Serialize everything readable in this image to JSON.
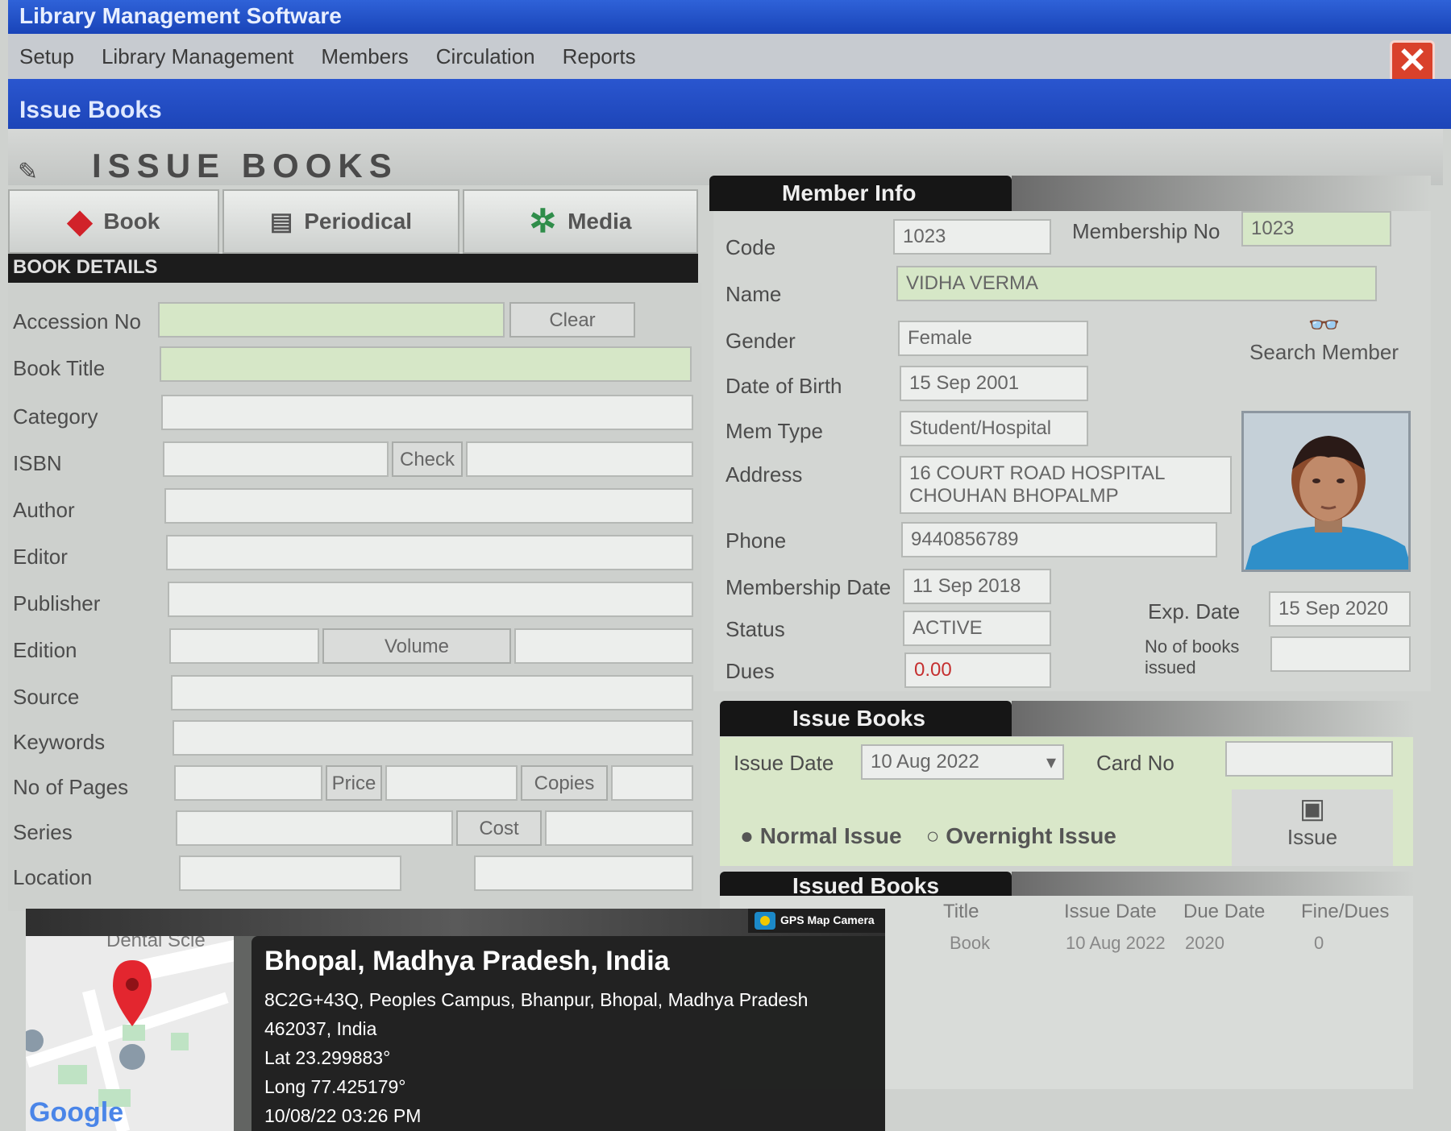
{
  "window": {
    "title": "Library Management Software"
  },
  "menu": [
    "Setup",
    "Library Management",
    "Members",
    "Circulation",
    "Reports"
  ],
  "subwindow": {
    "title": "Issue Books"
  },
  "form": {
    "heading": "ISSUE BOOKS"
  },
  "tabs": [
    "Book",
    "Periodical",
    "Media"
  ],
  "book_details": {
    "header": "BOOK DETAILS",
    "labels": [
      "Accession No",
      "Book Title",
      "Category",
      "ISBN",
      "Author",
      "Editor",
      "Publisher",
      "Edition",
      "Source",
      "Keywords",
      "No of Pages",
      "Series",
      "Location"
    ],
    "buttons": {
      "clear": "Clear",
      "check": "Check",
      "volume": "Volume",
      "price": "Price",
      "copies": "Copies",
      "cost": "Cost"
    }
  },
  "member_info": {
    "header": "Member Info",
    "labels": {
      "code": "Code",
      "membership_no": "Membership No",
      "name": "Name",
      "gender": "Gender",
      "dob": "Date of Birth",
      "member_type": "Mem Type",
      "address": "Address",
      "phone": "Phone",
      "membership_date": "Membership Date",
      "status": "Status",
      "dues": "Dues",
      "exp_date": "Exp. Date",
      "books_issued": "No of books issued"
    },
    "values": {
      "code": "1023",
      "membership_no": "1023",
      "name": "VIDHA VERMA",
      "gender": "Female",
      "dob": "15 Sep 2001",
      "member_type": "Student/Hospital",
      "address_1": "16 COURT ROAD HOSPITAL",
      "address_2": "CHOUHAN BHOPALMP",
      "phone": "9440856789",
      "membership_date": "11 Sep 2018",
      "status": "ACTIVE",
      "dues": "0.00",
      "exp_date": "15 Sep 2020",
      "books_issued": ""
    },
    "search_member": "Search Member"
  },
  "issue": {
    "header": "Issue Books",
    "issue_date_label": "Issue Date",
    "issue_date": "10 Aug 2022",
    "card_no_label": "Card No",
    "normal": "Normal Issue",
    "overnight": "Overnight Issue",
    "issue_button": "Issue"
  },
  "issued_books": {
    "header": "Issued Books",
    "columns": [
      "Title",
      "Issue Date",
      "Due Date",
      "Fine/Dues"
    ],
    "rows": [
      [
        "Book",
        "10 Aug 2022",
        "2020",
        "0"
      ]
    ]
  },
  "gps": {
    "app": "GPS Map Camera",
    "place": "Bhopal, Madhya Pradesh, India",
    "address_1": "8C2G+43Q, Peoples Campus, Bhanpur, Bhopal, Madhya Pradesh",
    "address_2": "462037, India",
    "lat": "Lat 23.299883°",
    "long": "Long 77.425179°",
    "datetime": "10/08/22 03:26 PM",
    "map_label": "Dental Scie",
    "map_brand": "Google"
  },
  "colors": {
    "title_bar": "#1d48c0",
    "green_field": "#d6e7c7",
    "dark_header": "#161616",
    "close_button": "#d9412b"
  }
}
